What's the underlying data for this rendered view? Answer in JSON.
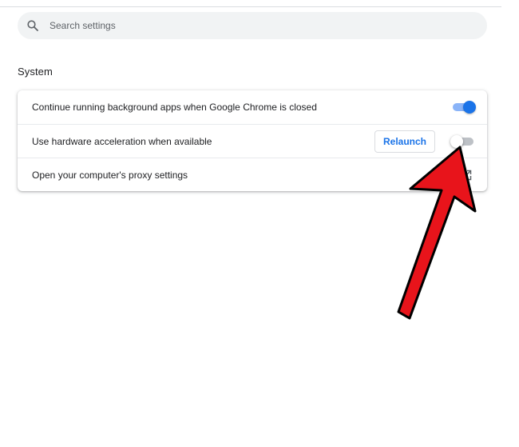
{
  "search": {
    "placeholder": "Search settings",
    "icon": "search-icon"
  },
  "section": {
    "title": "System"
  },
  "settings": {
    "background_apps": {
      "label": "Continue running background apps when Google Chrome is closed",
      "enabled": true
    },
    "hardware_acceleration": {
      "label": "Use hardware acceleration when available",
      "button_label": "Relaunch",
      "enabled": false
    },
    "proxy": {
      "label": "Open your computer's proxy settings",
      "icon": "open-external-icon"
    }
  },
  "colors": {
    "accent": "#1a73e8",
    "annotation_arrow": "#e8141b"
  }
}
